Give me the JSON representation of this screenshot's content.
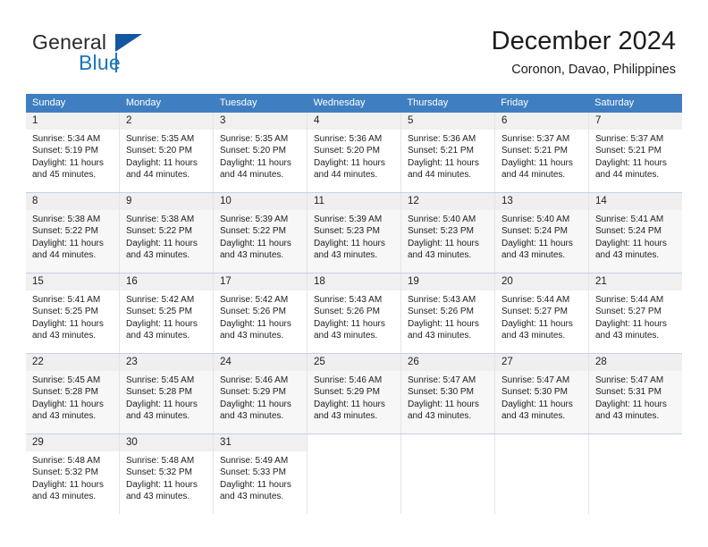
{
  "brand": {
    "word1": "General",
    "word2": "Blue",
    "accent_color": "#1b75bb",
    "triangle_color": "#1257a0"
  },
  "header": {
    "month_title": "December 2024",
    "location": "Coronon, Davao, Philippines"
  },
  "calendar": {
    "header_bg": "#3f7fc1",
    "weekdays": [
      "Sunday",
      "Monday",
      "Tuesday",
      "Wednesday",
      "Thursday",
      "Friday",
      "Saturday"
    ],
    "weeks": [
      {
        "shaded": false,
        "days": [
          {
            "num": "1",
            "sunrise": "Sunrise: 5:34 AM",
            "sunset": "Sunset: 5:19 PM",
            "daylight1": "Daylight: 11 hours",
            "daylight2": "and 45 minutes."
          },
          {
            "num": "2",
            "sunrise": "Sunrise: 5:35 AM",
            "sunset": "Sunset: 5:20 PM",
            "daylight1": "Daylight: 11 hours",
            "daylight2": "and 44 minutes."
          },
          {
            "num": "3",
            "sunrise": "Sunrise: 5:35 AM",
            "sunset": "Sunset: 5:20 PM",
            "daylight1": "Daylight: 11 hours",
            "daylight2": "and 44 minutes."
          },
          {
            "num": "4",
            "sunrise": "Sunrise: 5:36 AM",
            "sunset": "Sunset: 5:20 PM",
            "daylight1": "Daylight: 11 hours",
            "daylight2": "and 44 minutes."
          },
          {
            "num": "5",
            "sunrise": "Sunrise: 5:36 AM",
            "sunset": "Sunset: 5:21 PM",
            "daylight1": "Daylight: 11 hours",
            "daylight2": "and 44 minutes."
          },
          {
            "num": "6",
            "sunrise": "Sunrise: 5:37 AM",
            "sunset": "Sunset: 5:21 PM",
            "daylight1": "Daylight: 11 hours",
            "daylight2": "and 44 minutes."
          },
          {
            "num": "7",
            "sunrise": "Sunrise: 5:37 AM",
            "sunset": "Sunset: 5:21 PM",
            "daylight1": "Daylight: 11 hours",
            "daylight2": "and 44 minutes."
          }
        ]
      },
      {
        "shaded": true,
        "days": [
          {
            "num": "8",
            "sunrise": "Sunrise: 5:38 AM",
            "sunset": "Sunset: 5:22 PM",
            "daylight1": "Daylight: 11 hours",
            "daylight2": "and 44 minutes."
          },
          {
            "num": "9",
            "sunrise": "Sunrise: 5:38 AM",
            "sunset": "Sunset: 5:22 PM",
            "daylight1": "Daylight: 11 hours",
            "daylight2": "and 43 minutes."
          },
          {
            "num": "10",
            "sunrise": "Sunrise: 5:39 AM",
            "sunset": "Sunset: 5:22 PM",
            "daylight1": "Daylight: 11 hours",
            "daylight2": "and 43 minutes."
          },
          {
            "num": "11",
            "sunrise": "Sunrise: 5:39 AM",
            "sunset": "Sunset: 5:23 PM",
            "daylight1": "Daylight: 11 hours",
            "daylight2": "and 43 minutes."
          },
          {
            "num": "12",
            "sunrise": "Sunrise: 5:40 AM",
            "sunset": "Sunset: 5:23 PM",
            "daylight1": "Daylight: 11 hours",
            "daylight2": "and 43 minutes."
          },
          {
            "num": "13",
            "sunrise": "Sunrise: 5:40 AM",
            "sunset": "Sunset: 5:24 PM",
            "daylight1": "Daylight: 11 hours",
            "daylight2": "and 43 minutes."
          },
          {
            "num": "14",
            "sunrise": "Sunrise: 5:41 AM",
            "sunset": "Sunset: 5:24 PM",
            "daylight1": "Daylight: 11 hours",
            "daylight2": "and 43 minutes."
          }
        ]
      },
      {
        "shaded": false,
        "days": [
          {
            "num": "15",
            "sunrise": "Sunrise: 5:41 AM",
            "sunset": "Sunset: 5:25 PM",
            "daylight1": "Daylight: 11 hours",
            "daylight2": "and 43 minutes."
          },
          {
            "num": "16",
            "sunrise": "Sunrise: 5:42 AM",
            "sunset": "Sunset: 5:25 PM",
            "daylight1": "Daylight: 11 hours",
            "daylight2": "and 43 minutes."
          },
          {
            "num": "17",
            "sunrise": "Sunrise: 5:42 AM",
            "sunset": "Sunset: 5:26 PM",
            "daylight1": "Daylight: 11 hours",
            "daylight2": "and 43 minutes."
          },
          {
            "num": "18",
            "sunrise": "Sunrise: 5:43 AM",
            "sunset": "Sunset: 5:26 PM",
            "daylight1": "Daylight: 11 hours",
            "daylight2": "and 43 minutes."
          },
          {
            "num": "19",
            "sunrise": "Sunrise: 5:43 AM",
            "sunset": "Sunset: 5:26 PM",
            "daylight1": "Daylight: 11 hours",
            "daylight2": "and 43 minutes."
          },
          {
            "num": "20",
            "sunrise": "Sunrise: 5:44 AM",
            "sunset": "Sunset: 5:27 PM",
            "daylight1": "Daylight: 11 hours",
            "daylight2": "and 43 minutes."
          },
          {
            "num": "21",
            "sunrise": "Sunrise: 5:44 AM",
            "sunset": "Sunset: 5:27 PM",
            "daylight1": "Daylight: 11 hours",
            "daylight2": "and 43 minutes."
          }
        ]
      },
      {
        "shaded": true,
        "days": [
          {
            "num": "22",
            "sunrise": "Sunrise: 5:45 AM",
            "sunset": "Sunset: 5:28 PM",
            "daylight1": "Daylight: 11 hours",
            "daylight2": "and 43 minutes."
          },
          {
            "num": "23",
            "sunrise": "Sunrise: 5:45 AM",
            "sunset": "Sunset: 5:28 PM",
            "daylight1": "Daylight: 11 hours",
            "daylight2": "and 43 minutes."
          },
          {
            "num": "24",
            "sunrise": "Sunrise: 5:46 AM",
            "sunset": "Sunset: 5:29 PM",
            "daylight1": "Daylight: 11 hours",
            "daylight2": "and 43 minutes."
          },
          {
            "num": "25",
            "sunrise": "Sunrise: 5:46 AM",
            "sunset": "Sunset: 5:29 PM",
            "daylight1": "Daylight: 11 hours",
            "daylight2": "and 43 minutes."
          },
          {
            "num": "26",
            "sunrise": "Sunrise: 5:47 AM",
            "sunset": "Sunset: 5:30 PM",
            "daylight1": "Daylight: 11 hours",
            "daylight2": "and 43 minutes."
          },
          {
            "num": "27",
            "sunrise": "Sunrise: 5:47 AM",
            "sunset": "Sunset: 5:30 PM",
            "daylight1": "Daylight: 11 hours",
            "daylight2": "and 43 minutes."
          },
          {
            "num": "28",
            "sunrise": "Sunrise: 5:47 AM",
            "sunset": "Sunset: 5:31 PM",
            "daylight1": "Daylight: 11 hours",
            "daylight2": "and 43 minutes."
          }
        ]
      },
      {
        "shaded": false,
        "days": [
          {
            "num": "29",
            "sunrise": "Sunrise: 5:48 AM",
            "sunset": "Sunset: 5:32 PM",
            "daylight1": "Daylight: 11 hours",
            "daylight2": "and 43 minutes."
          },
          {
            "num": "30",
            "sunrise": "Sunrise: 5:48 AM",
            "sunset": "Sunset: 5:32 PM",
            "daylight1": "Daylight: 11 hours",
            "daylight2": "and 43 minutes."
          },
          {
            "num": "31",
            "sunrise": "Sunrise: 5:49 AM",
            "sunset": "Sunset: 5:33 PM",
            "daylight1": "Daylight: 11 hours",
            "daylight2": "and 43 minutes."
          },
          {
            "num": "",
            "sunrise": "",
            "sunset": "",
            "daylight1": "",
            "daylight2": ""
          },
          {
            "num": "",
            "sunrise": "",
            "sunset": "",
            "daylight1": "",
            "daylight2": ""
          },
          {
            "num": "",
            "sunrise": "",
            "sunset": "",
            "daylight1": "",
            "daylight2": ""
          },
          {
            "num": "",
            "sunrise": "",
            "sunset": "",
            "daylight1": "",
            "daylight2": ""
          }
        ]
      }
    ]
  }
}
